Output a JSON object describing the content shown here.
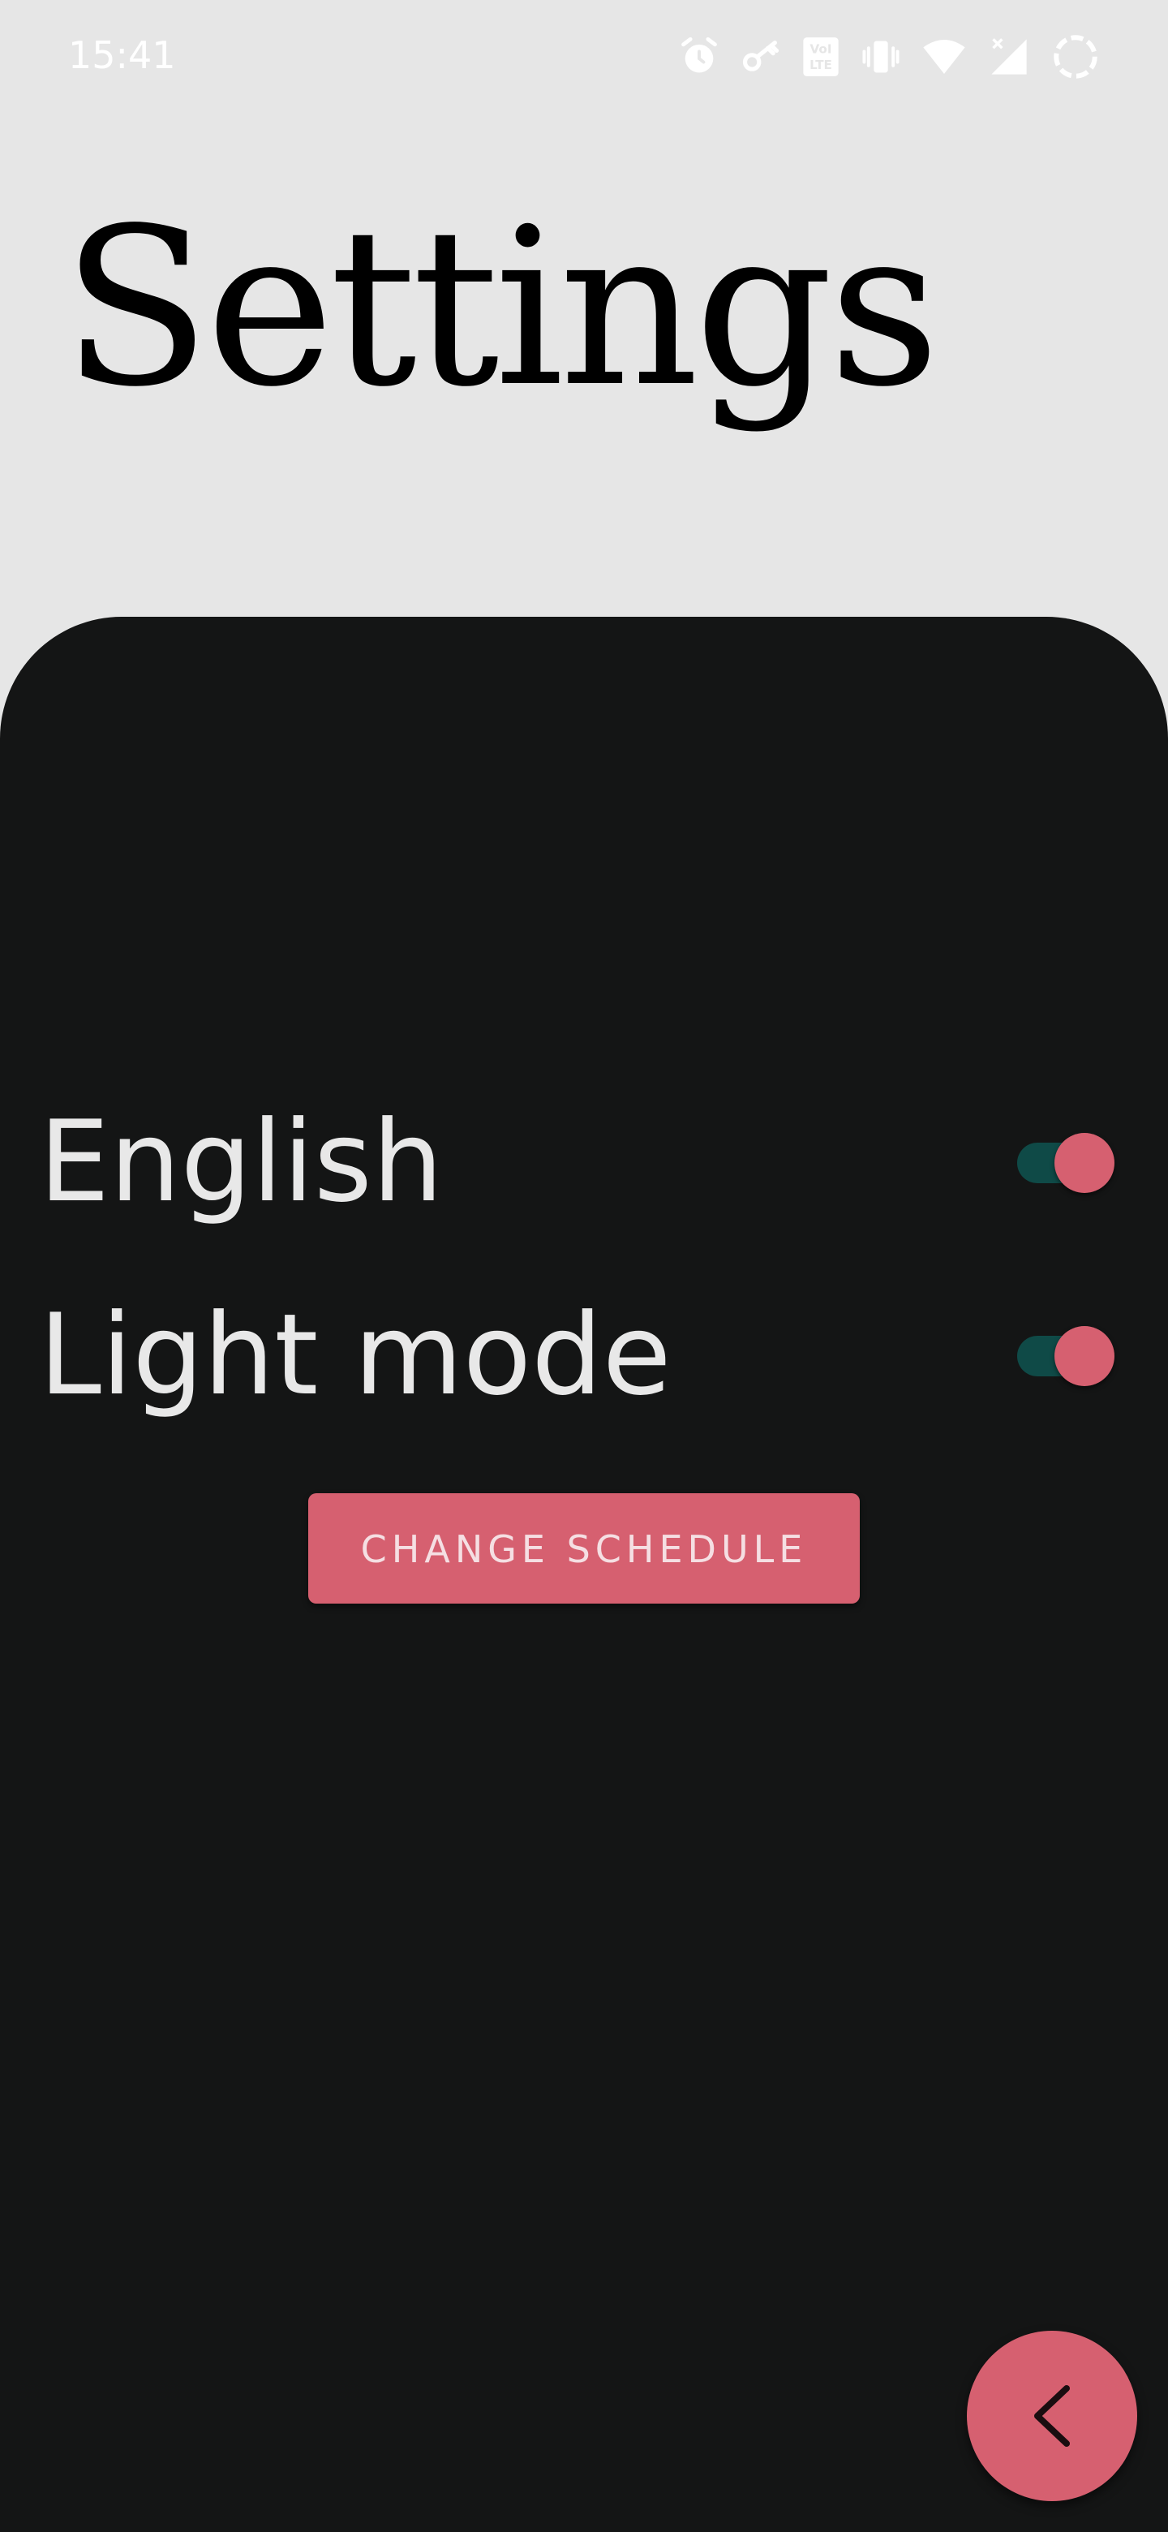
{
  "status_bar": {
    "time": "15:41",
    "icons": [
      "alarm-icon",
      "key-icon",
      "volte-icon",
      "vibrate-icon",
      "wifi-icon",
      "signal-icon",
      "battery-icon"
    ]
  },
  "title": "Settings",
  "settings": [
    {
      "label": "English",
      "enabled": true
    },
    {
      "label": "Light mode",
      "enabled": true
    }
  ],
  "change_schedule_label": "CHANGE SCHEDULE",
  "back_fab_icon": "chevron-left-icon",
  "colors": {
    "background": "#e6e6e6",
    "panel": "#141515",
    "accent": "#d66070",
    "toggle_track": "#0f4a47",
    "text_light": "#e8e8e8"
  }
}
